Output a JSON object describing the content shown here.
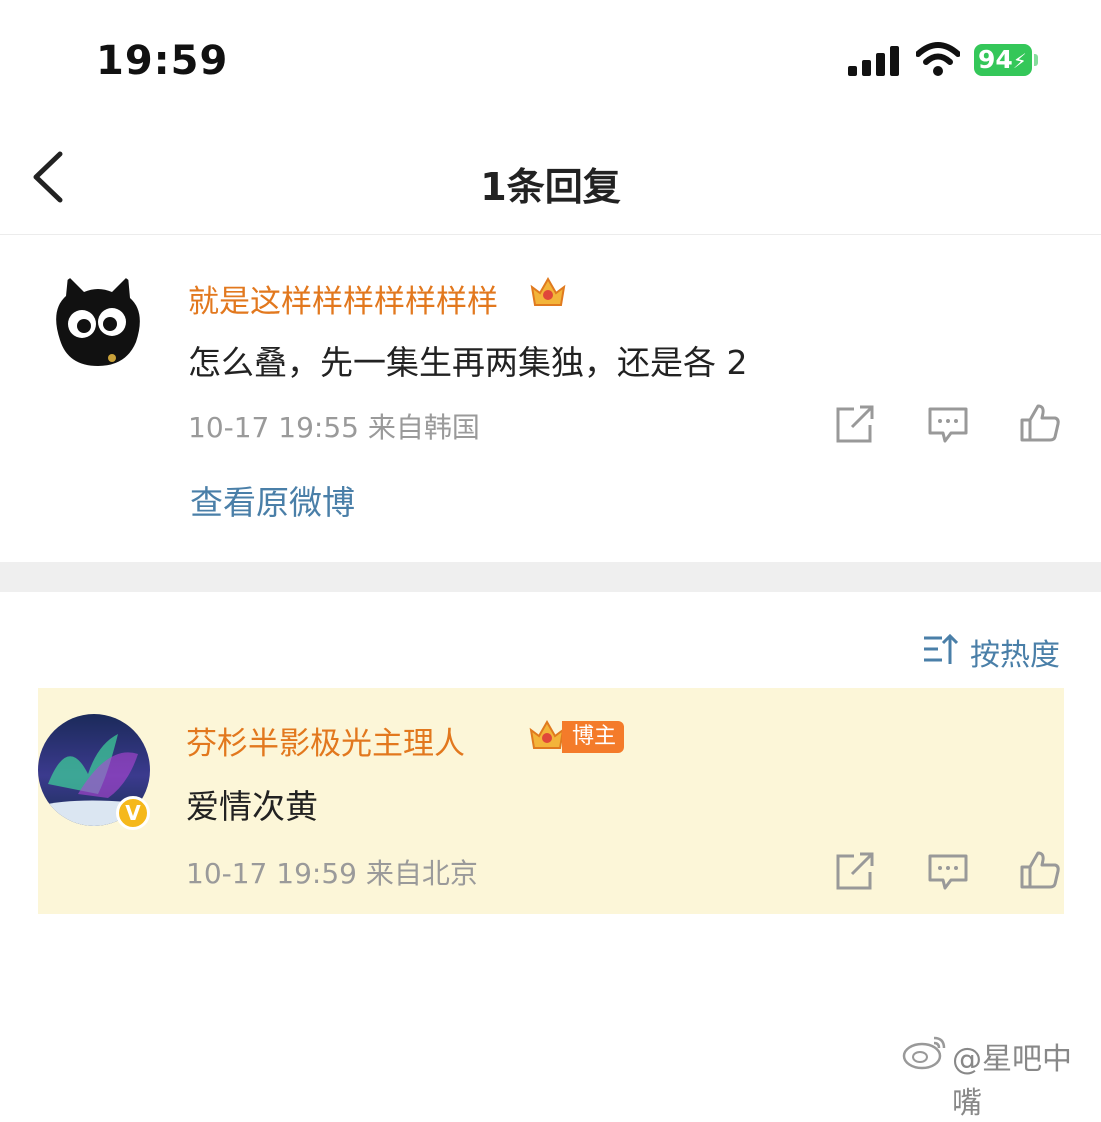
{
  "status_bar": {
    "time": "19:59",
    "battery": "94"
  },
  "nav": {
    "title": "1条回复"
  },
  "root_comment": {
    "username": "就是这样样样样样样样",
    "text": "怎么叠，先一集生再两集独，还是各 2",
    "meta": "10-17 19:55  来自韩国",
    "view_original_label": "查看原微博"
  },
  "sort": {
    "label": "按热度"
  },
  "reply": {
    "username": "芬杉半影极光主理人",
    "host_badge": "博主",
    "verified_mark": "V",
    "text": "爱情次黄",
    "meta": "10-17 19:59  来自北京"
  },
  "watermark": {
    "text": "@星吧中嘴"
  },
  "colors": {
    "username": "#e2781e",
    "link": "#4a7fa8",
    "highlight_bg": "#fcf6d8",
    "battery": "#34c759"
  },
  "icons": [
    "back-arrow-icon",
    "signal-icon",
    "wifi-icon",
    "crown-icon",
    "share-icon",
    "comment-icon",
    "like-icon",
    "sort-icon",
    "weibo-logo-icon"
  ]
}
